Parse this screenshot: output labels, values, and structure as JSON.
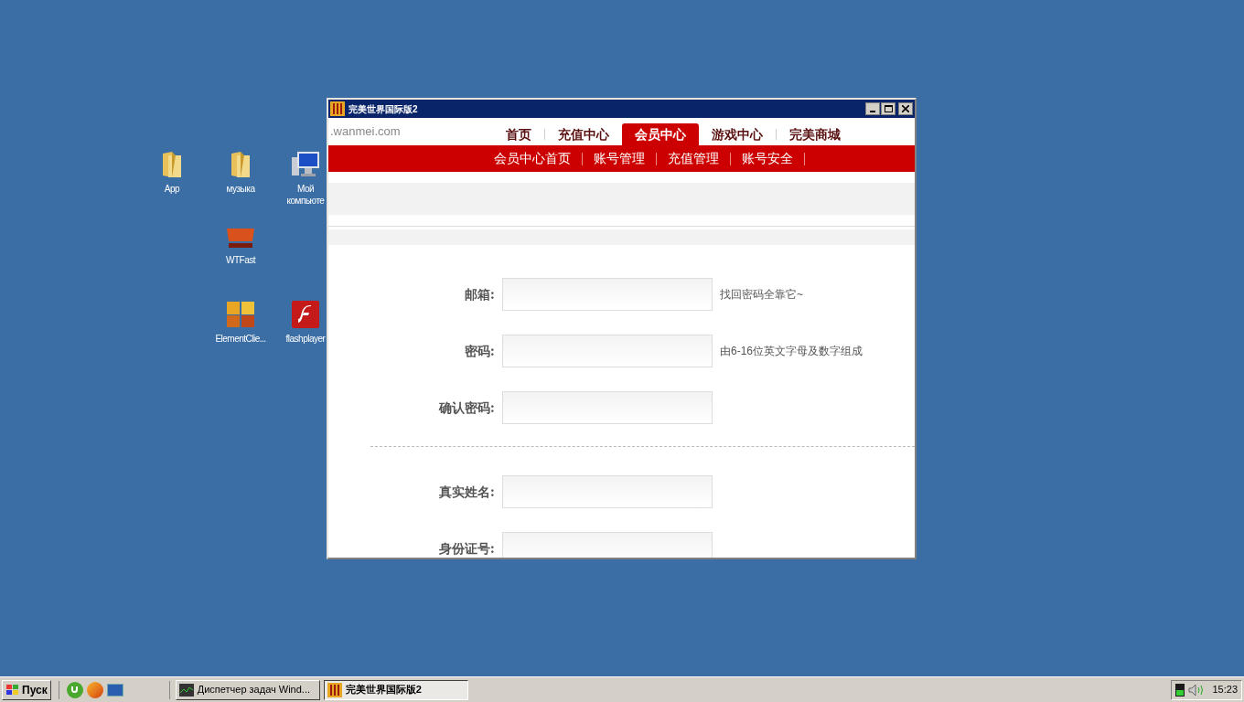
{
  "desktop_icons": [
    {
      "kind": "folder",
      "label": "App"
    },
    {
      "kind": "folder",
      "label": "музыка"
    },
    {
      "kind": "computer",
      "label": "Мой компьюте"
    },
    {
      "kind": "wtf",
      "label": "WTFast"
    },
    {
      "kind": "game",
      "label": "ElementClie..."
    },
    {
      "kind": "flash",
      "label": "flashplayer"
    }
  ],
  "window": {
    "title": "完美世界国际版2",
    "logo_text": ".wanmei.com",
    "nav": [
      {
        "label": "首页",
        "selected": false
      },
      {
        "label": "充值中心",
        "selected": false
      },
      {
        "label": "会员中心",
        "selected": true
      },
      {
        "label": "游戏中心",
        "selected": false
      },
      {
        "label": "完美商城",
        "selected": false
      }
    ],
    "subnav": [
      "会员中心首页",
      "账号管理",
      "充值管理",
      "账号安全"
    ],
    "form_sections": [
      [
        {
          "label": "邮箱:",
          "hint": "找回密码全靠它~"
        },
        {
          "label": "密码:",
          "hint": "由6-16位英文字母及数字组成"
        },
        {
          "label": "确认密码:"
        }
      ],
      [
        {
          "label": "真实姓名:"
        },
        {
          "label": "身份证号:"
        }
      ]
    ]
  },
  "taskbar": {
    "start": "Пуск",
    "tasks": [
      {
        "label": "Диспетчер задач Wind...",
        "kind": "taskmgr",
        "selected": false
      },
      {
        "label": "完美世界国际版2",
        "kind": "game",
        "selected": true
      }
    ],
    "clock": "15:23"
  }
}
